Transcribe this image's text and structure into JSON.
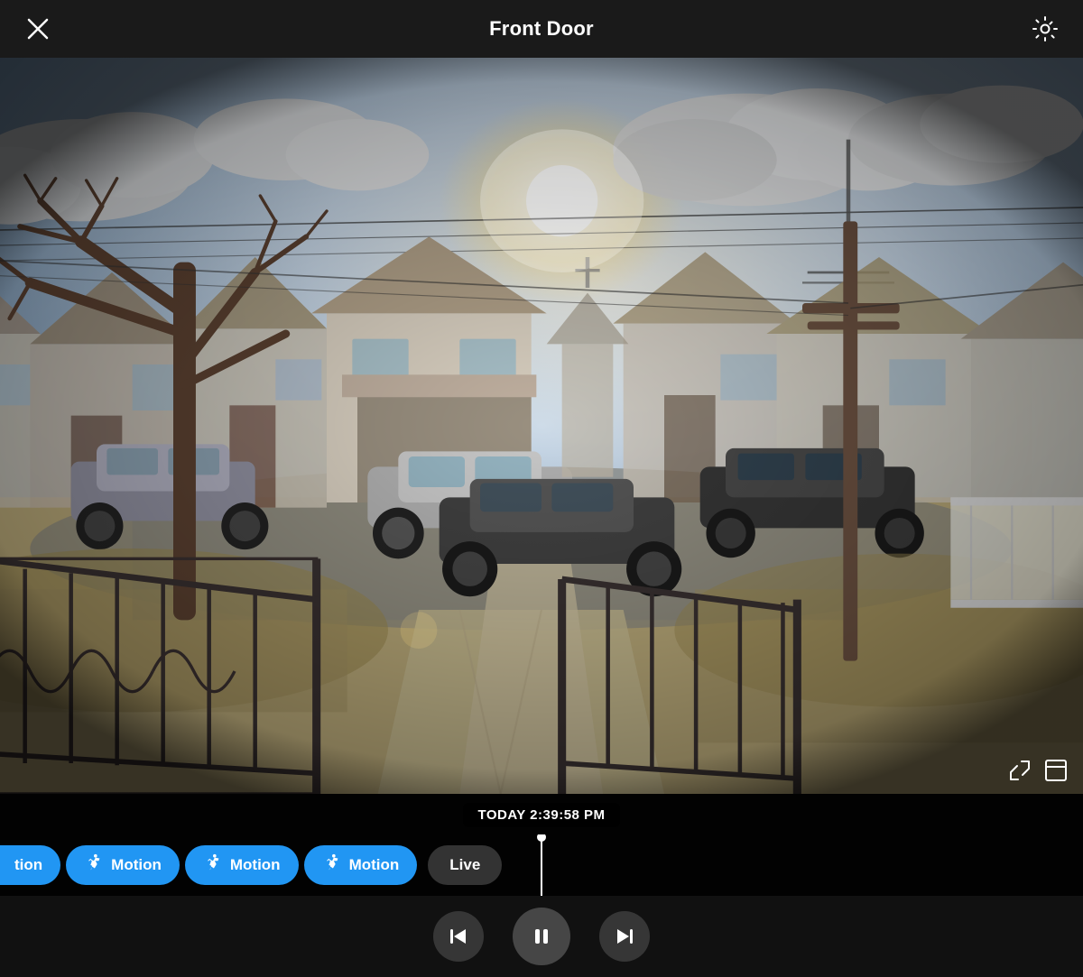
{
  "header": {
    "title": "Front Door",
    "close_label": "close",
    "settings_label": "settings"
  },
  "timestamp": {
    "label": "TODAY 2:39:58 PM"
  },
  "timeline": {
    "items": [
      {
        "type": "partial_motion",
        "label": "tion"
      },
      {
        "type": "motion",
        "label": "Motion"
      },
      {
        "type": "motion",
        "label": "Motion"
      },
      {
        "type": "motion",
        "label": "Motion"
      },
      {
        "type": "live",
        "label": "Live"
      }
    ]
  },
  "controls": {
    "prev_label": "previous",
    "pause_label": "pause",
    "next_label": "next"
  },
  "overlay": {
    "expand_icon": "expand",
    "fullscreen_icon": "fullscreen"
  }
}
